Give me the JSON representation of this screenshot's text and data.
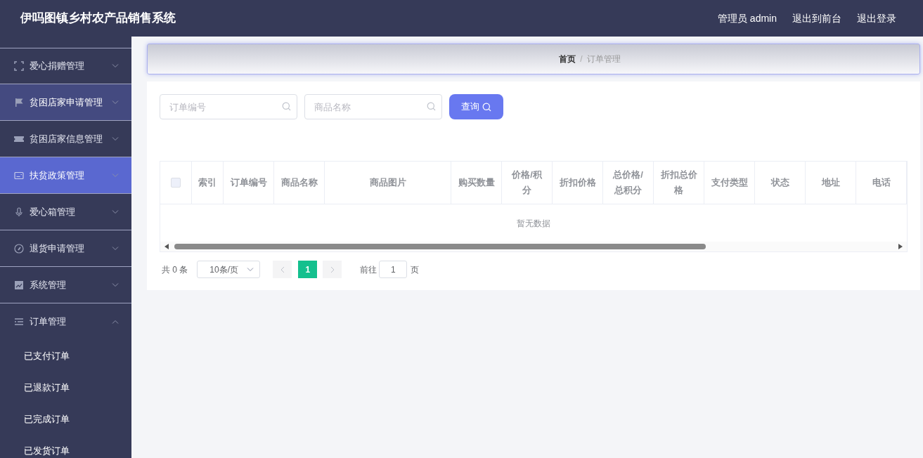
{
  "header": {
    "title": "伊吗图镇乡村农产品销售系统",
    "links": [
      "管理员 admin",
      "退出到前台",
      "退出登录"
    ]
  },
  "sidebar": {
    "items": [
      {
        "label": "爱心捐赠管理",
        "selected": false,
        "hovered": false,
        "expanded": false
      },
      {
        "label": "贫困店家申请管理",
        "selected": false,
        "hovered": true,
        "expanded": false
      },
      {
        "label": "贫困店家信息管理",
        "selected": false,
        "hovered": false,
        "expanded": false
      },
      {
        "label": "扶贫政策管理",
        "selected": true,
        "hovered": false,
        "expanded": false
      },
      {
        "label": "爱心箱管理",
        "selected": false,
        "hovered": false,
        "expanded": false
      },
      {
        "label": "退货申请管理",
        "selected": false,
        "hovered": false,
        "expanded": false
      },
      {
        "label": "系统管理",
        "selected": false,
        "hovered": false,
        "expanded": false
      },
      {
        "label": "订单管理",
        "selected": false,
        "hovered": false,
        "expanded": true,
        "children": [
          {
            "label": "已支付订单"
          },
          {
            "label": "已退款订单"
          },
          {
            "label": "已完成订单"
          },
          {
            "label": "已发货订单"
          }
        ]
      }
    ]
  },
  "breadcrumb": {
    "items": [
      "首页",
      "订单管理"
    ],
    "separator": "/"
  },
  "search": {
    "fields": [
      {
        "placeholder": "订单编号"
      },
      {
        "placeholder": "商品名称"
      }
    ],
    "button": "查询"
  },
  "table": {
    "columns": [
      "索引",
      "订单编号",
      "商品名称",
      "商品图片",
      "购买数量",
      "价格/积分",
      "折扣价格",
      "总价格/总积分",
      "折扣总价格",
      "支付类型",
      "状态",
      "地址",
      "电话"
    ],
    "empty_text": "暂无数据",
    "select_all_checked": false
  },
  "pagination": {
    "total": "共 0 条",
    "page_size": "10条/页",
    "pages": [
      {
        "label": "1",
        "selected": true
      }
    ],
    "goto_label": "前往",
    "goto_value": "1",
    "goto_suffix": "页"
  }
}
